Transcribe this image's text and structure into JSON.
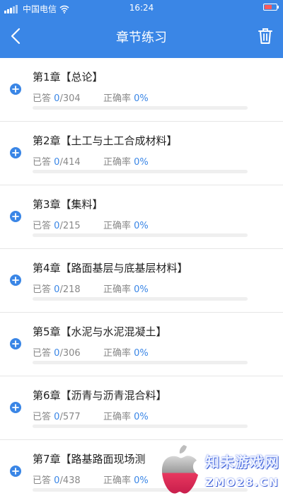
{
  "status_bar": {
    "carrier": "中国电信",
    "time": "16:24",
    "battery_level": 0.6,
    "battery_color": "#ff5a5a"
  },
  "nav": {
    "title": "章节练习",
    "back_icon": "chevron-left-icon",
    "trash_icon": "trash-icon"
  },
  "colors": {
    "accent": "#3a86e6"
  },
  "chapters": [
    {
      "name": "第1章【总论】",
      "answered_label": "已答",
      "answered": "0",
      "total": "/304",
      "rate_label": "正确率",
      "rate": "0%",
      "progress": 0
    },
    {
      "name": "第2章【土工与土工合成材料】",
      "answered_label": "已答",
      "answered": "0",
      "total": "/414",
      "rate_label": "正确率",
      "rate": "0%",
      "progress": 0
    },
    {
      "name": "第3章【集料】",
      "answered_label": "已答",
      "answered": "0",
      "total": "/215",
      "rate_label": "正确率",
      "rate": "0%",
      "progress": 0
    },
    {
      "name": "第4章【路面基层与底基层材料】",
      "answered_label": "已答",
      "answered": "0",
      "total": "/218",
      "rate_label": "正确率",
      "rate": "0%",
      "progress": 0
    },
    {
      "name": "第5章【水泥与水泥混凝土】",
      "answered_label": "已答",
      "answered": "0",
      "total": "/306",
      "rate_label": "正确率",
      "rate": "0%",
      "progress": 0
    },
    {
      "name": "第6章【沥青与沥青混合料】",
      "answered_label": "已答",
      "answered": "0",
      "total": "/577",
      "rate_label": "正确率",
      "rate": "0%",
      "progress": 0
    },
    {
      "name": "第7章【路基路面现场测",
      "answered_label": "已答",
      "answered": "0",
      "total": "/438",
      "rate_label": "正确率",
      "rate": "0%",
      "progress": 0
    }
  ],
  "watermark": {
    "line1": "知未游戏网",
    "line2": "ZMO28.CN"
  }
}
